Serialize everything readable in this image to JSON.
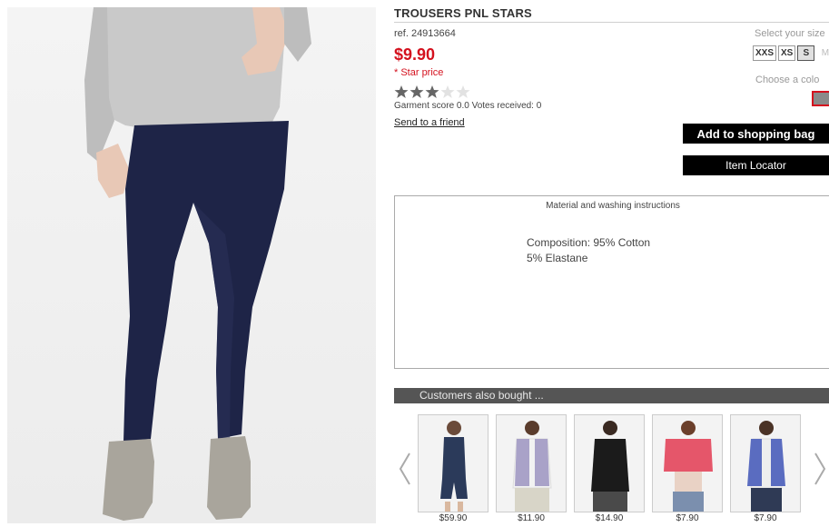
{
  "product": {
    "title": "TROUSERS PNL STARS",
    "ref": "ref. 24913664",
    "price": "$9.90",
    "price_note": "* Star price",
    "rating": 3,
    "rating_max": 5,
    "score_text": "Garment score 0.0 Votes received: 0",
    "send_link": "Send to a friend",
    "image_icon": "leggings-photo"
  },
  "size": {
    "label": "Select your size",
    "options": [
      "XXS",
      "XS",
      "S",
      "M"
    ],
    "selected": "S"
  },
  "color": {
    "label": "Choose a colo",
    "swatch": "#8a8a8a",
    "selected_border": "#d4111e"
  },
  "actions": {
    "add_to_bag": "Add to shopping bag",
    "item_locator": "Item Locator"
  },
  "material": {
    "title": "Material and washing instructions",
    "line1": "Composition: 95% Cotton",
    "line2": "5% Elastane"
  },
  "also_bought": {
    "title": "Customers also bought ...",
    "items": [
      {
        "price": "$59.90",
        "icon": "denim-romper-photo"
      },
      {
        "price": "$11.90",
        "icon": "lilac-vest-photo"
      },
      {
        "price": "$14.90",
        "icon": "black-fringe-vest-photo"
      },
      {
        "price": "$7.90",
        "icon": "coral-cropped-jacket-photo"
      },
      {
        "price": "$7.90",
        "icon": "blue-vest-photo"
      }
    ]
  },
  "colors": {
    "accent_red": "#d4111e",
    "button_black": "#000000",
    "bar_gray": "#555555"
  }
}
